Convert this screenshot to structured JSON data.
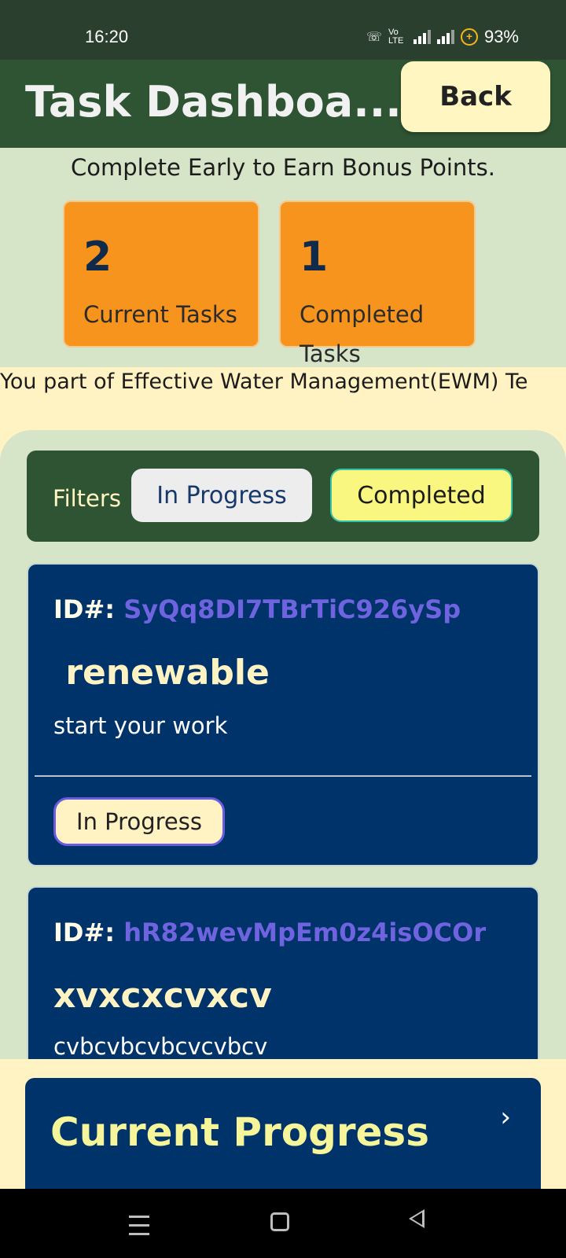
{
  "status_bar": {
    "time": "16:20",
    "network_label": "Vo LTE",
    "battery": "93%",
    "icons": [
      "wifi-call-icon",
      "signal-icon",
      "signal-icon",
      "battery-saver-icon"
    ]
  },
  "app_bar": {
    "title": "Task Dashboa...",
    "back_label": "Back"
  },
  "bonus_text": "Complete Early to Earn Bonus Points.",
  "stats": [
    {
      "value": "2",
      "label": "Current Tasks"
    },
    {
      "value": "1",
      "label": "Completed Tasks"
    }
  ],
  "team_text": "You part of Effective Water Management(EWM) Te",
  "filters": {
    "label": "Filters",
    "in_progress": "In Progress",
    "completed": "Completed"
  },
  "tasks": [
    {
      "id_label": "ID#:",
      "id": "SyQq8DI7TBrTiC926ySp",
      "name": " renewable",
      "description": "start your work",
      "status": "In Progress"
    },
    {
      "id_label": "ID#:",
      "id": "hR82wevMpEm0z4isOCOr",
      "name": "xvxcxcvxcv",
      "description": "cvbcvbcvbcvcvbcv"
    }
  ],
  "progress": {
    "title": "Current Progress",
    "chevron": "›"
  },
  "colors": {
    "app_bar": "#2f5433",
    "accent_orange": "#f7941d",
    "card_navy": "#00336a",
    "cream": "#fff3c4",
    "id_purple": "#6f63e0",
    "completed_chip": "#f9f77f"
  }
}
